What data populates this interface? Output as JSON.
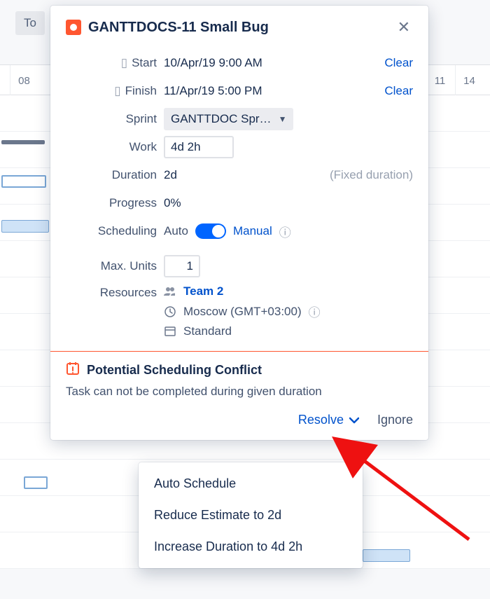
{
  "background": {
    "toolbar_first": "To",
    "date_left": "08",
    "date_right1": "11",
    "date_right2": "14"
  },
  "popover": {
    "title": "GANTTDOCS-11 Small Bug",
    "fields": {
      "start_label": "Start",
      "start_value": "10/Apr/19 9:00 AM",
      "start_clear": "Clear",
      "finish_label": "Finish",
      "finish_value": "11/Apr/19 5:00 PM",
      "finish_clear": "Clear",
      "sprint_label": "Sprint",
      "sprint_value": "GANTTDOC Spr…",
      "work_label": "Work",
      "work_value": "4d 2h",
      "duration_label": "Duration",
      "duration_value": "2d",
      "duration_note": "(Fixed duration)",
      "progress_label": "Progress",
      "progress_value": "0%",
      "scheduling_label": "Scheduling",
      "scheduling_auto": "Auto",
      "scheduling_manual": "Manual",
      "maxunits_label": "Max. Units",
      "maxunits_value": "1",
      "resources_label": "Resources",
      "team_name": "Team 2",
      "timezone": "Moscow (GMT+03:00)",
      "calendar": "Standard"
    },
    "conflict": {
      "title": "Potential Scheduling Conflict",
      "message": "Task can not be completed during given duration",
      "resolve": "Resolve",
      "ignore": "Ignore"
    }
  },
  "dropdown": {
    "items": [
      "Auto Schedule",
      "Reduce Estimate to 2d",
      "Increase Duration to 4d 2h"
    ]
  }
}
